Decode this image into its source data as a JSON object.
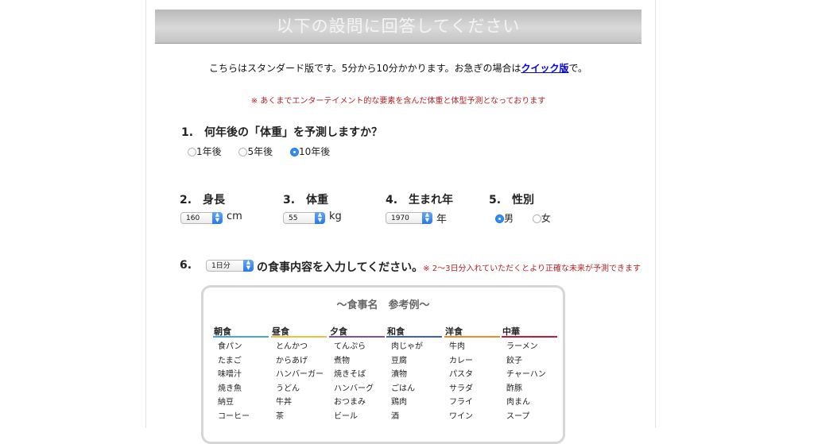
{
  "header": {
    "title": "以下の設問に回答してください"
  },
  "intro": {
    "text_before": "こちらはスタンダード版です。5分から10分かかります。お急ぎの場合は",
    "link": "クイック版",
    "text_after": "で。"
  },
  "note": "※ あくまでエンターテイメント的な要素を含んだ体重と体型予測となっております",
  "q1": {
    "label": "1.　何年後の「体重」を予測しますか？",
    "options": [
      "1年後",
      "5年後",
      "10年後"
    ],
    "selected_index": 2
  },
  "q2": {
    "label": "2.　身長",
    "value": "160",
    "unit": "cm"
  },
  "q3": {
    "label": "3.　体重",
    "value": "55",
    "unit": "kg"
  },
  "q4": {
    "label": "4.　生まれ年",
    "value": "1970",
    "unit": "年"
  },
  "q5": {
    "label": "5.　性別",
    "options": [
      "男",
      "女"
    ],
    "selected_index": 0
  },
  "q6": {
    "number": "6.",
    "select_value": "1日分",
    "label": "の食事内容を入力してください。",
    "note": "※ 2〜3日分入れていただくとより正確な未来が予測できます"
  },
  "meals": {
    "title": "〜食事名　参考例〜",
    "columns": [
      {
        "name": "朝食",
        "color": "#4aa3df",
        "items": [
          "食パン",
          "たまご",
          "味噌汁",
          "焼き魚",
          "納豆",
          "コーヒー"
        ]
      },
      {
        "name": "昼食",
        "color": "#f0c040",
        "items": [
          "とんかつ",
          "からあげ",
          "ハンバーガー",
          "うどん",
          "牛丼",
          "茶"
        ]
      },
      {
        "name": "夕食",
        "color": "#7b4fb5",
        "items": [
          "てんぷら",
          "煮物",
          "焼きそば",
          "ハンバーグ",
          "おつまみ",
          "ビール"
        ]
      },
      {
        "name": "和食",
        "color": "#3a5fc8",
        "items": [
          "肉じゃが",
          "豆腐",
          "漬物",
          "ごはん",
          "鶏肉",
          "酒"
        ]
      },
      {
        "name": "洋食",
        "color": "#ee8a2a",
        "items": [
          "牛肉",
          "カレー",
          "パスタ",
          "サラダ",
          "フライ",
          "ワイン"
        ]
      },
      {
        "name": "中華",
        "color": "#c8183a",
        "items": [
          "ラーメン",
          "餃子",
          "チャーハン",
          "酢豚",
          "肉まん",
          "スープ"
        ]
      }
    ]
  }
}
